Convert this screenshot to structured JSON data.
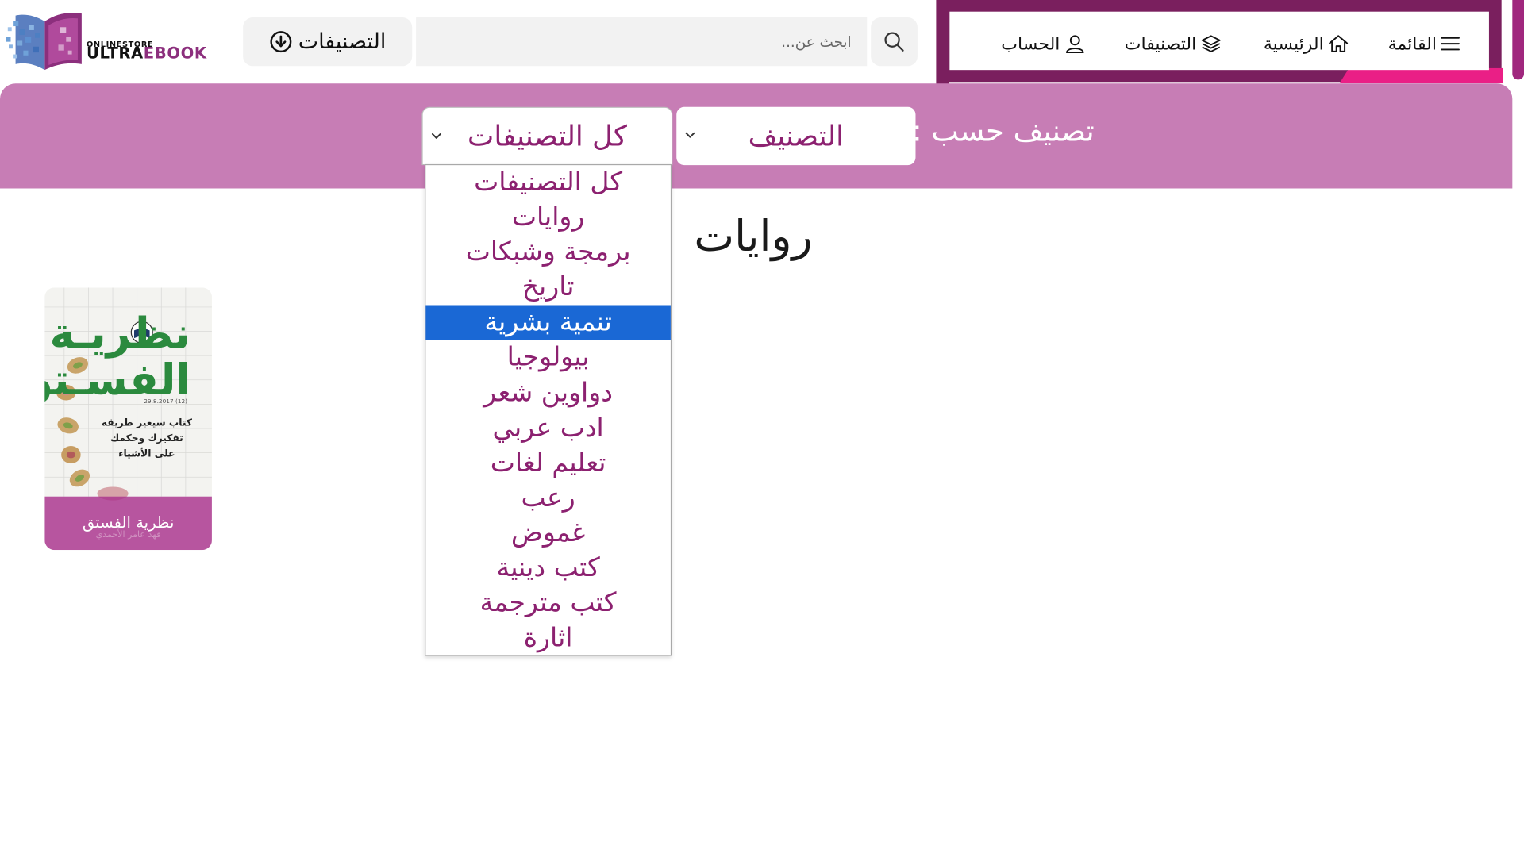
{
  "brand": {
    "small_text": "ONLINESTORE",
    "big_text_a": "ULTRA",
    "big_text_b": "EBOOK"
  },
  "search": {
    "categories_button_label": "التصنيفات",
    "placeholder": "ابحث عن...",
    "value": ""
  },
  "nav": {
    "menu_label": "القائمة",
    "home_label": "الرئيسية",
    "categories_label": "التصنيفات",
    "account_label": "الحساب"
  },
  "filter": {
    "sort_by_label": "تصنيف حسب :",
    "classify_select_value": "التصنيف",
    "category_select_value": "كل التصنيفات",
    "category_options": [
      "كل التصنيفات",
      "روايات",
      "برمجة وشبكات",
      "تاريخ",
      "تنمية بشرية",
      "بيولوجيا",
      "دواوين شعر",
      "ادب عربي",
      "تعليم لغات",
      "رعب",
      "غموض",
      "كتب دينية",
      "كتب مترجمة",
      "اثارة"
    ],
    "highlighted_option": "تنمية بشرية"
  },
  "page": {
    "title": "روايات"
  },
  "books": [
    {
      "title": "نظرية الفستق",
      "cover_title_line1": "نظريـة",
      "cover_title_line2": "الفسـتق",
      "cover_date": "29.8.2017 (12)",
      "cover_tagline_1": "كتاب سيغير طريقة",
      "cover_tagline_2": "تفكيرك وحكمك",
      "cover_tagline_3": "على الأشياء",
      "author": "فهد عامر الأحمدي"
    }
  ],
  "colors": {
    "filter_band": "#c77db5",
    "accent_text": "#8c2170",
    "nav_frame": "#7a1f5e",
    "nav_accent": "#ea1f86",
    "highlight": "#1a68d5",
    "cover_green": "#2b8a3e"
  },
  "icons": {
    "search": "search-icon",
    "download_circle": "arrow-down-circle-icon",
    "menu": "hamburger-icon",
    "home": "home-icon",
    "categories": "layers-icon",
    "account": "user-icon",
    "chevron": "chevron-down-icon"
  }
}
